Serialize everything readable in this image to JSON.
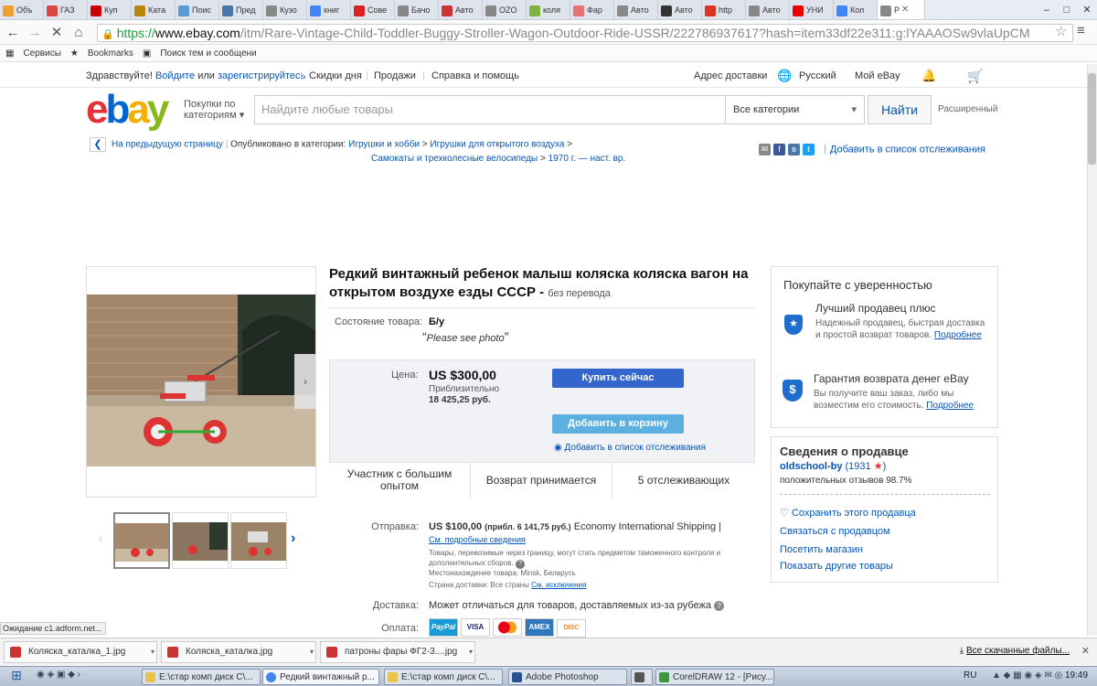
{
  "browser": {
    "tabs": [
      "Объ",
      "ГАЗ",
      "Куп",
      "Ката",
      "Поис",
      "Пред",
      "Кузо",
      "книг",
      "Сове",
      "Бачо",
      "Авто",
      "OZO",
      "коля",
      "Фар",
      "Авто",
      "Авто",
      "http",
      "Авто",
      "УНИ",
      "Кол",
      "Р"
    ],
    "tab_colors": [
      "#f0a030",
      "#d44",
      "#c00",
      "#b8860b",
      "#5a9bd4",
      "#4a76a8",
      "#888",
      "#4285f4",
      "#d22",
      "#888",
      "#c33",
      "#888",
      "#7cb342",
      "#e57373",
      "#888",
      "#333",
      "#d32",
      "#888",
      "#e00",
      "#4285f4",
      "#888"
    ],
    "url_scheme": "https://",
    "url_host": "www.ebay.com",
    "url_path": "/itm/Rare-Vintage-Child-Toddler-Buggy-Stroller-Wagon-Outdoor-Ride-USSR/222786937617?hash=item33df22e311:g:lYAAAOSw9vlaUpCM",
    "bookmarks": [
      "Сервисы",
      "Bookmarks",
      "Поиск тем и сообщени"
    ],
    "status_text": "Ожидание c1.adform.net..."
  },
  "topbar": {
    "greeting": "Здравствуйте!",
    "signin": "Войдите",
    "or": "или",
    "register": "зарегистрируйтесь",
    "deals": "Скидки дня",
    "selling": "Продажи",
    "help": "Справка и помощь",
    "shipto": "Адрес доставки",
    "language": "Русский",
    "myebay": "Мой eBay"
  },
  "header": {
    "logo": [
      "e",
      "b",
      "a",
      "y"
    ],
    "shop_by": "Покупки по",
    "shop_by2": "категориям",
    "search_placeholder": "Найдите любые товары",
    "category": "Все категории",
    "find": "Найти",
    "advanced": "Расширенный"
  },
  "breadcrumbs": {
    "back": "На предыдущую страницу",
    "listed_in": "Опубликовано в категории:",
    "path": [
      "Игрушки и хобби",
      "Игрушки для открытого воздуха",
      "Самокаты и трехколесные велосипеды",
      "1970 г. — наст. вр."
    ],
    "watchlist": "Добавить в список отслеживания"
  },
  "item": {
    "title": "Редкий винтажный ребенок малыш коляска коляска вагон на открытом воздухе езды СССР -",
    "no_translation": "без перевода",
    "condition_label": "Состояние товара:",
    "condition": "Б/у",
    "condition_note": "Please see photo",
    "price_label": "Цена:",
    "price": "US $300,00",
    "approx_label": "Приблизительно",
    "approx": "18 425,25 руб.",
    "buy_now": "Купить сейчас",
    "add_to_cart": "Добавить в корзину",
    "add_watch": "Добавить в список отслеживания",
    "stats": [
      "Участник с большим опытом",
      "Возврат принимается",
      "5 отслеживающих"
    ]
  },
  "shipping": {
    "label": "Отправка:",
    "price": "US $100,00",
    "approx": "(прибл. 6 141,75 руб.)",
    "method": "Economy International Shipping |",
    "details": "См. подробные сведения",
    "note": "Товары, перевозимые через границу, могут стать предметом таможенного контроля и дополнительных сборов.",
    "location": "Местонахождение товара: Minsk, Беларусь",
    "countries": "Страна доставки: Все страны",
    "exclusions": "См. исключения",
    "delivery_label": "Доставка:",
    "delivery": "Может отличаться для товаров, доставляемых из-за рубежа",
    "payment_label": "Оплата:",
    "payments": [
      "PayPal",
      "VISA",
      "MC",
      "AMEX",
      "DISC"
    ]
  },
  "trust": {
    "heading": "Покупайте с уверенностью",
    "top_title": "Лучший продавец плюс",
    "top_text": "Надежный продавец, быстрая доставка и простой возврат товаров.",
    "top_more": "Подробнее",
    "mb_title": "Гарантия возврата денег eBay",
    "mb_text": "Вы получите ваш заказ, либо мы возместим его стоимость.",
    "mb_more": "Подробнее"
  },
  "seller": {
    "heading": "Сведения о продавце",
    "name": "oldschool-by",
    "score": "(1931",
    "score_end": ")",
    "feedback": "положительных отзывов 98.7%",
    "links": [
      "Сохранить этого продавца",
      "Связаться с продавцом",
      "Посетить магазин",
      "Показать другие товары"
    ]
  },
  "downloads": {
    "items": [
      "Коляска_каталка_1.jpg",
      "Коляска_каталка.jpg",
      "патроны фары ФГ2-3....jpg"
    ],
    "all": "Все скачанные файлы..."
  },
  "taskbar": {
    "items": [
      "E:\\стар комп диск C\\...",
      "Редкий винтажный р...",
      "E:\\стар комп диск C\\...",
      "Adobe Photoshop",
      "",
      "CorelDRAW 12 - [Рису..."
    ],
    "lang": "RU",
    "clock": "19:49"
  }
}
